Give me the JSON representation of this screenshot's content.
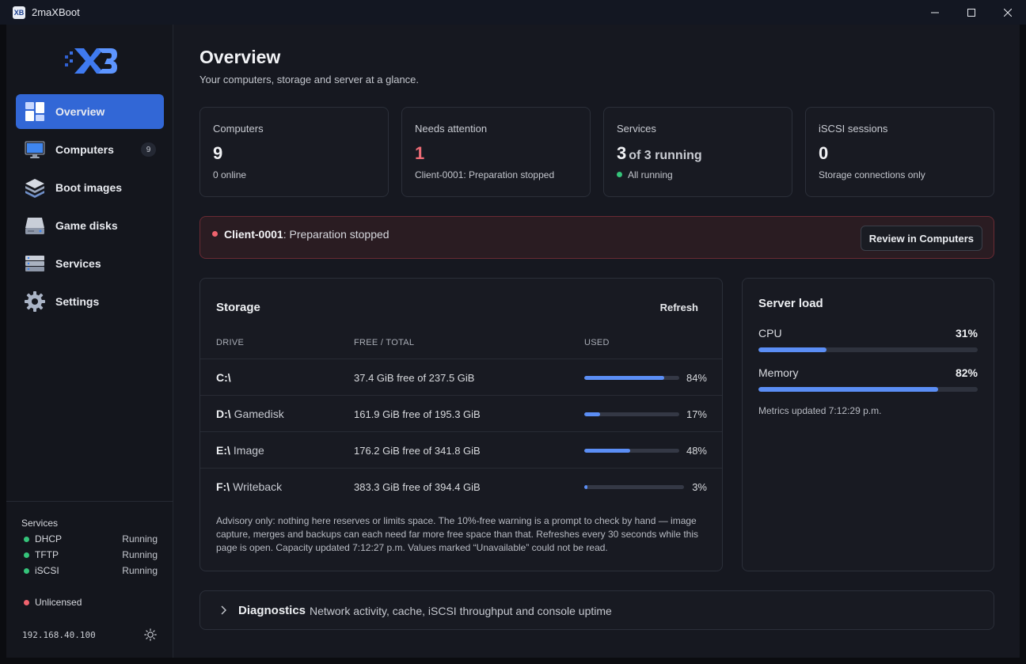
{
  "window": {
    "title": "2maXBoot",
    "app_icon_text": "XB"
  },
  "sidebar": {
    "logo": "XB",
    "items": [
      {
        "label": "Overview",
        "icon": "dashboard-icon",
        "active": true
      },
      {
        "label": "Computers",
        "icon": "monitor-icon",
        "badge": "9"
      },
      {
        "label": "Boot images",
        "icon": "layers-icon"
      },
      {
        "label": "Game disks",
        "icon": "hard-drive-icon"
      },
      {
        "label": "Services",
        "icon": "server-icon"
      },
      {
        "label": "Settings",
        "icon": "gear-icon"
      }
    ],
    "services_heading": "Services",
    "services": [
      {
        "name": "DHCP",
        "status": "Running"
      },
      {
        "name": "TFTP",
        "status": "Running"
      },
      {
        "name": "iSCSI",
        "status": "Running"
      }
    ],
    "license": "Unlicensed",
    "ip": "192.168.40.100"
  },
  "page": {
    "title": "Overview",
    "subtitle": "Your computers, storage and server at a glance."
  },
  "stats": [
    {
      "label": "Computers",
      "value": "9",
      "sub": "0 online"
    },
    {
      "label": "Needs attention",
      "value": "1",
      "sub": "Client-0001: Preparation stopped"
    },
    {
      "label": "Services",
      "value": "3",
      "suffix": "of 3 running",
      "sub": "All running"
    },
    {
      "label": "iSCSI sessions",
      "value": "0",
      "sub": "Storage connections only"
    }
  ],
  "alert": {
    "client": "Client-0001",
    "message": ": Preparation stopped",
    "button": "Review in Computers"
  },
  "storage": {
    "title": "Storage",
    "refresh": "Refresh",
    "columns": [
      "DRIVE",
      "FREE / TOTAL",
      "USED"
    ],
    "drives": [
      {
        "letter": "C:\\",
        "name": "",
        "free": "37.4 GiB free of 237.5 GiB",
        "used_pct": 84,
        "used_label": "84%"
      },
      {
        "letter": "D:\\",
        "name": "Gamedisk",
        "free": "161.9 GiB free of 195.3 GiB",
        "used_pct": 17,
        "used_label": "17%"
      },
      {
        "letter": "E:\\",
        "name": "Image",
        "free": "176.2 GiB free of 341.8 GiB",
        "used_pct": 48,
        "used_label": "48%"
      },
      {
        "letter": "F:\\",
        "name": "Writeback",
        "free": "383.3 GiB free of 394.4 GiB",
        "used_pct": 3,
        "used_label": "3%"
      }
    ],
    "advisory": "Advisory only: nothing here reserves or limits space. The 10%-free warning is a prompt to check by hand — image capture, merges and backups can each need far more free space than that. Refreshes every 30 seconds while this page is open. Capacity updated 7:12:27 p.m. Values marked “Unavailable” could not be read."
  },
  "server_load": {
    "title": "Server load",
    "cpu_label": "CPU",
    "cpu_pct": 31,
    "cpu_text": "31%",
    "memory_label": "Memory",
    "memory_pct": 82,
    "memory_text": "82%",
    "updated": "Metrics updated 7:12:29 p.m."
  },
  "diagnostics": {
    "title": "Diagnostics",
    "subtitle": "Network activity, cache, iSCSI throughput and console uptime"
  },
  "colors": {
    "accent": "#3267d6",
    "bar": "#5b8ef5",
    "ok": "#35c47a",
    "danger": "#ef6c76"
  }
}
